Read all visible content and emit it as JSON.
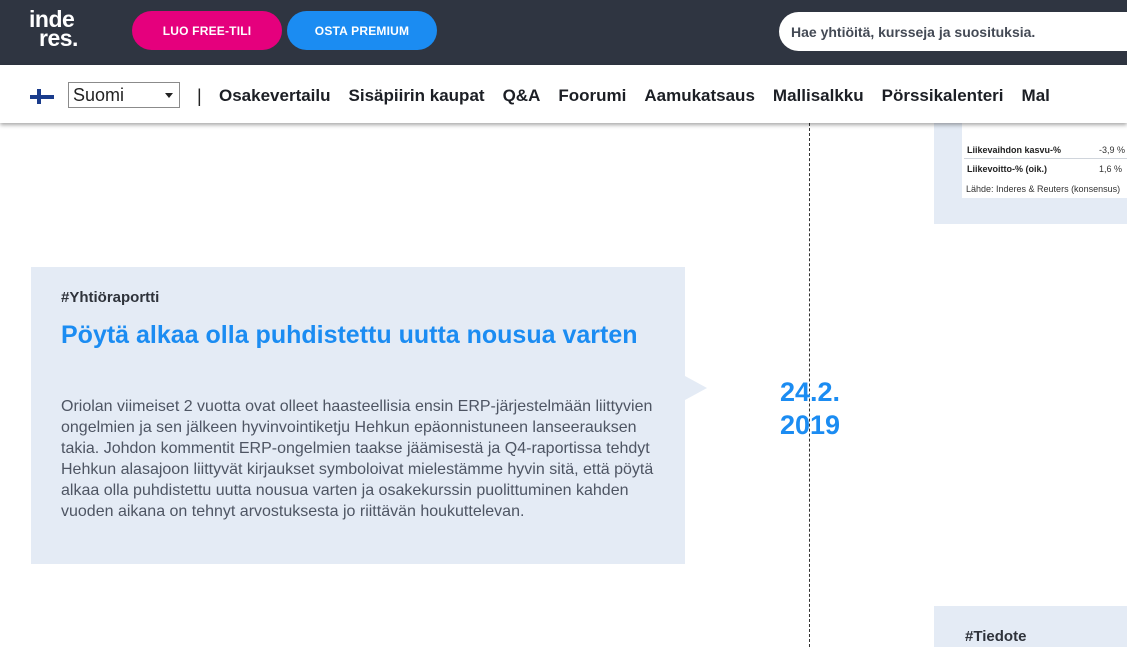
{
  "header": {
    "logo_line1": "inde",
    "logo_line2": "res.",
    "free_button": "LUO FREE-TILI",
    "premium_button": "OSTA PREMIUM",
    "search_placeholder": "Hae yhtiöitä, kursseja ja suosituksia."
  },
  "nav": {
    "language": "Suomi",
    "separator": "|",
    "links": [
      "Osakevertailu",
      "Sisäpiirin kaupat",
      "Q&A",
      "Foorumi",
      "Aamukatsaus",
      "Mallisalkku",
      "Pörssikalenteri",
      "Mal"
    ]
  },
  "stats": {
    "rows": [
      {
        "label": "Liikevaihdon kasvu-%",
        "value": "-3,9 %"
      },
      {
        "label": "Liikevoitto-% (oik.)",
        "value": "1,6 %"
      }
    ],
    "source": "Lähde: Inderes & Reuters  (konsensus)"
  },
  "article": {
    "tag": "#Yhtiöraportti",
    "title": "Pöytä alkaa olla puhdistettu uutta nousua varten",
    "body": "Oriolan viimeiset 2 vuotta ovat olleet haasteellisia ensin ERP-järjestelmään liittyvien ongelmien ja sen jälkeen hyvinvointiketju Hehkun epäonnistuneen lanseerauksen takia. Johdon kommentit ERP-ongelmien taakse jäämisestä ja Q4-raportissa tehdyt Hehkun alasajoon liittyvät kirjaukset symboloivat mielestämme hyvin sitä, että pöytä alkaa olla puhdistettu uutta nousua varten ja osakekurssin puolittuminen kahden vuoden aikana on tehnyt arvostuksesta jo riittävän houkuttelevan.",
    "date_day": "24.2.",
    "date_year": "2019"
  },
  "next_item": {
    "tag": "#Tiedote"
  },
  "colors": {
    "topbar": "#2f3541",
    "pink": "#e5007d",
    "blue": "#1b8cf2",
    "card_bg": "#e4ebf5"
  }
}
